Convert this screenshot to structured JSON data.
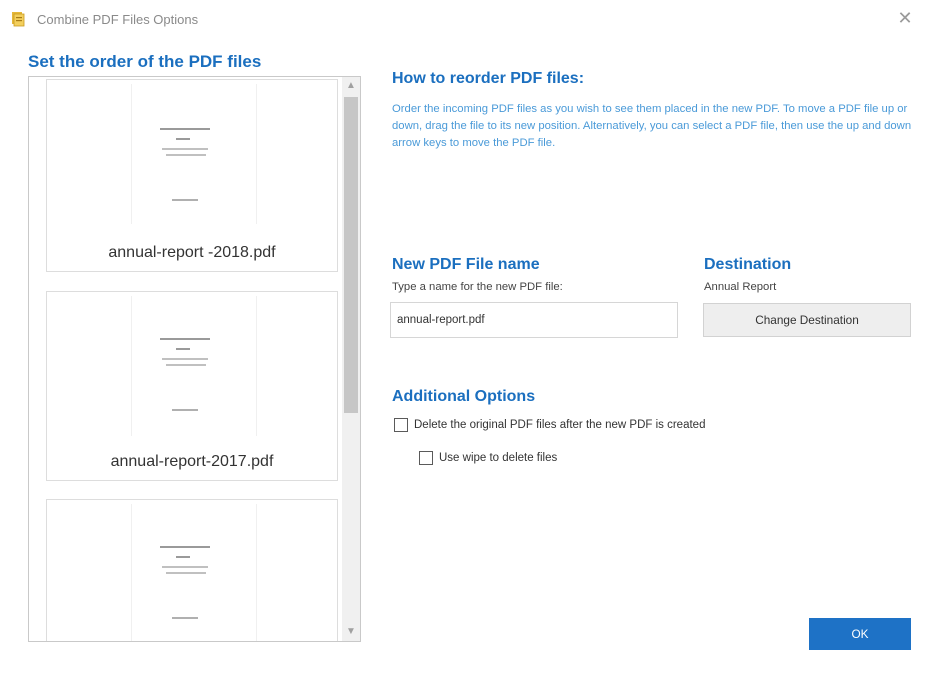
{
  "window": {
    "title": "Combine PDF Files Options"
  },
  "left": {
    "heading": "Set the order of the PDF files",
    "files": [
      {
        "label": "annual-report -2018.pdf"
      },
      {
        "label": "annual-report-2017.pdf"
      },
      {
        "label": ""
      }
    ]
  },
  "how": {
    "heading": "How to reorder PDF files:",
    "text": "Order the incoming PDF files as you wish to see them placed in the new PDF. To move a PDF file up or down, drag the file to its new position. Alternatively, you can select a PDF file, then use the up and down arrow keys to move the PDF file."
  },
  "new_name": {
    "heading": "New PDF File name",
    "sublabel": "Type a name for the new PDF file:",
    "value": "annual-report.pdf"
  },
  "destination": {
    "heading": "Destination",
    "value": "Annual Report",
    "button_label": "Change Destination"
  },
  "options": {
    "heading": "Additional Options",
    "delete_label": "Delete the original PDF files after the new PDF is created",
    "wipe_label": "Use wipe to delete files"
  },
  "buttons": {
    "ok_label": "OK"
  },
  "colors": {
    "heading_blue": "#1b6fbf",
    "text_blue": "#4a9ad8",
    "ok_blue": "#1e72c6"
  },
  "icons": {
    "close": "close-icon",
    "app": "app-icon"
  }
}
